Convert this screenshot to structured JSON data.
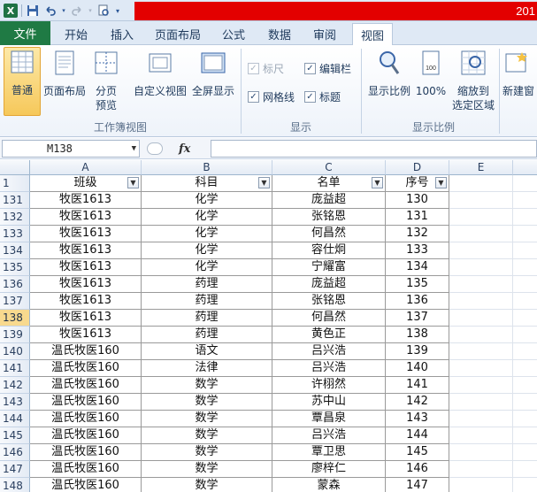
{
  "titlebar": {
    "app_text": "201"
  },
  "tabs": [
    {
      "label": "文件"
    },
    {
      "label": "开始"
    },
    {
      "label": "插入"
    },
    {
      "label": "页面布局"
    },
    {
      "label": "公式"
    },
    {
      "label": "数据"
    },
    {
      "label": "审阅"
    },
    {
      "label": "视图"
    }
  ],
  "ribbon": {
    "workbook_views": {
      "label": "工作簿视图",
      "normal": "普通",
      "page_layout": "页面布局",
      "page_break_line1": "分页",
      "page_break_line2": "预览",
      "custom_views": "自定义视图",
      "full_screen": "全屏显示"
    },
    "show": {
      "label": "显示",
      "ruler": "标尺",
      "formula_bar": "编辑栏",
      "gridlines": "网格线",
      "headings": "标题"
    },
    "zoom": {
      "label": "显示比例",
      "zoom": "显示比例",
      "zoom_100": "100%",
      "zoom_sel_line1": "缩放到",
      "zoom_sel_line2": "选定区域"
    },
    "window": {
      "new_window": "新建窗"
    }
  },
  "formula_bar": {
    "name_box": "M138",
    "fx": "fx",
    "value": ""
  },
  "grid": {
    "columns": [
      "A",
      "B",
      "C",
      "D",
      "E"
    ],
    "header_row": {
      "row": "1",
      "cells": [
        "班级",
        "科目",
        "名单",
        "序号"
      ]
    },
    "selected_row": "138",
    "rows": [
      {
        "row": "131",
        "cells": [
          "牧医1613",
          "化学",
          "庞益超",
          "130"
        ]
      },
      {
        "row": "132",
        "cells": [
          "牧医1613",
          "化学",
          "张铭恩",
          "131"
        ]
      },
      {
        "row": "133",
        "cells": [
          "牧医1613",
          "化学",
          "何昌然",
          "132"
        ]
      },
      {
        "row": "134",
        "cells": [
          "牧医1613",
          "化学",
          "容仕炯",
          "133"
        ]
      },
      {
        "row": "135",
        "cells": [
          "牧医1613",
          "化学",
          "宁耀富",
          "134"
        ]
      },
      {
        "row": "136",
        "cells": [
          "牧医1613",
          "药理",
          "庞益超",
          "135"
        ]
      },
      {
        "row": "137",
        "cells": [
          "牧医1613",
          "药理",
          "张铭恩",
          "136"
        ]
      },
      {
        "row": "138",
        "cells": [
          "牧医1613",
          "药理",
          "何昌然",
          "137"
        ]
      },
      {
        "row": "139",
        "cells": [
          "牧医1613",
          "药理",
          "黄色正",
          "138"
        ]
      },
      {
        "row": "140",
        "cells": [
          "温氏牧医160",
          "语文",
          "吕兴浩",
          "139"
        ]
      },
      {
        "row": "141",
        "cells": [
          "温氏牧医160",
          "法律",
          "吕兴浩",
          "140"
        ]
      },
      {
        "row": "142",
        "cells": [
          "温氏牧医160",
          "数学",
          "许栩然",
          "141"
        ]
      },
      {
        "row": "143",
        "cells": [
          "温氏牧医160",
          "数学",
          "苏中山",
          "142"
        ]
      },
      {
        "row": "144",
        "cells": [
          "温氏牧医160",
          "数学",
          "覃昌泉",
          "143"
        ]
      },
      {
        "row": "145",
        "cells": [
          "温氏牧医160",
          "数学",
          "吕兴浩",
          "144"
        ]
      },
      {
        "row": "146",
        "cells": [
          "温氏牧医160",
          "数学",
          "覃卫思",
          "145"
        ]
      },
      {
        "row": "147",
        "cells": [
          "温氏牧医160",
          "数学",
          "廖梓仁",
          "146"
        ]
      },
      {
        "row": "148",
        "cells": [
          "温氏牧医160",
          "数学",
          "蒙森",
          "147"
        ]
      }
    ]
  }
}
